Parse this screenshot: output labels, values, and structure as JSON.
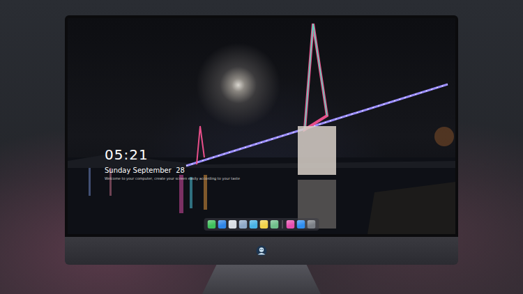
{
  "desktop": {
    "clock": "05:21",
    "date": "Sunday September  28",
    "hint": "Welcome to your computer, create your screen easily according to your taste"
  },
  "dock": {
    "items": [
      {
        "color": "#3fc25b"
      },
      {
        "color": "#2f86e8"
      },
      {
        "color": "#d9dde3"
      },
      {
        "color": "#8fa9c8"
      },
      {
        "color": "#49b3e6"
      },
      {
        "color": "#f2d34a"
      },
      {
        "color": "#6fbf8a"
      },
      {
        "color": "#e84fb0"
      },
      {
        "color": "#2f8ef0"
      },
      {
        "color": "#7b7f86"
      }
    ]
  }
}
